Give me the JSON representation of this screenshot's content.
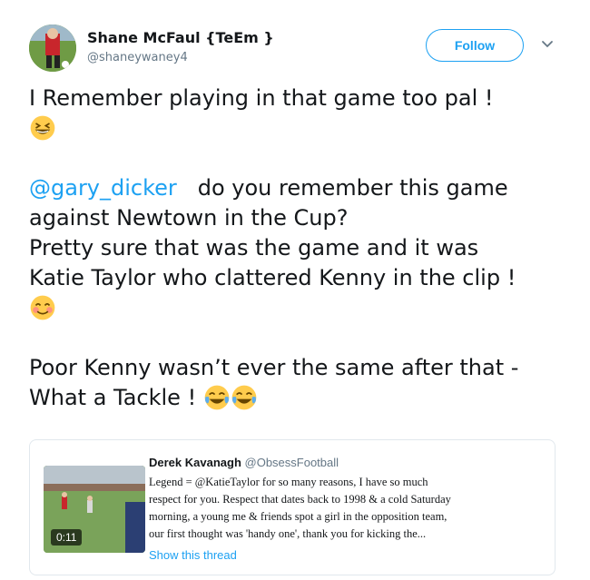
{
  "author": {
    "name": "Shane McFaul {TeEm }",
    "handle": "@shaneywaney4"
  },
  "follow_button_label": "Follow",
  "tweet": {
    "line1": "I Remember playing in that game too pal !",
    "mention": "@gary_dicker",
    "line3_rest": "do you remember this game",
    "line4": "against Newtown in the Cup?",
    "line5": "Pretty sure that was the game and it was",
    "line6": "Katie Taylor who clattered Kenny in the clip !",
    "line7": "Poor Kenny wasn’t ever the same  after that -",
    "line8": "What a Tackle !"
  },
  "emojis": {
    "first": "grinning-squinting-face",
    "second": "smiling-face-with-smiling-eyes",
    "third": "face-with-tears-of-joy",
    "fourth": "face-with-tears-of-joy"
  },
  "quoted_tweet": {
    "name": "Derek Kavanagh",
    "handle": "@ObsessFootball",
    "text_lines": [
      "Legend = @KatieTaylor for so many reasons, I have so much",
      "respect for you. Respect that dates back to 1998 & a cold Saturday",
      "morning, a young me & friends spot a girl in the opposition team,",
      "our first thought was 'handy one', thank you for kicking the..."
    ],
    "video_duration": "0:11",
    "show_thread": "Show this thread"
  },
  "colors": {
    "link": "#1da1f2",
    "secondary_text": "#657786",
    "card_border": "#e1e8ed"
  }
}
